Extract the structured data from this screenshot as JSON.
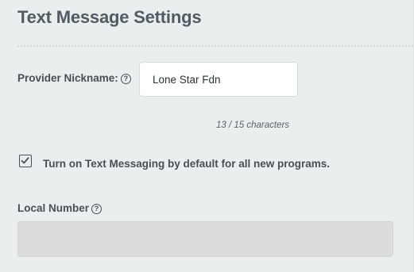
{
  "header": {
    "title": "Text Message Settings"
  },
  "provider_nickname": {
    "label": "Provider Nickname:",
    "help_icon": "question-circle-icon",
    "value": "Lone Star Fdn",
    "char_count": "13 / 15 characters"
  },
  "default_texting": {
    "checked": true,
    "label": "Turn on Text Messaging by default for all new programs."
  },
  "local_number": {
    "label": "Local Number",
    "help_icon": "question-circle-icon",
    "value": ""
  },
  "colors": {
    "background": "#eaeeee",
    "title": "#515b63",
    "label": "#4a4f55",
    "input_bg": "#ffffff",
    "disabled_input_bg": "#dcdcdc"
  }
}
